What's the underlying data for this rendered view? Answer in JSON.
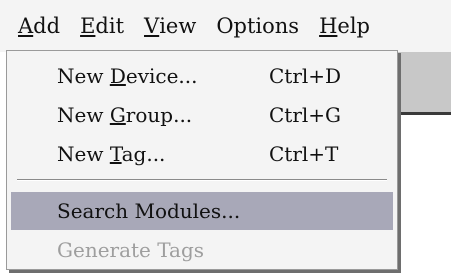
{
  "menubar": {
    "items": [
      {
        "label": "Add",
        "underline": "A",
        "rest": "dd"
      },
      {
        "label": "Edit",
        "underline": "E",
        "rest": "dit"
      },
      {
        "label": "View",
        "underline": "V",
        "rest": "iew"
      },
      {
        "label": "Options",
        "underline": "",
        "rest": "Options"
      },
      {
        "label": "Help",
        "underline": "H",
        "rest": "elp"
      }
    ]
  },
  "dropdown": {
    "items": [
      {
        "pre": "New ",
        "underline": "D",
        "post": "evice...",
        "shortcut": "Ctrl+D",
        "state": "normal"
      },
      {
        "pre": "New ",
        "underline": "G",
        "post": "roup...",
        "shortcut": "Ctrl+G",
        "state": "normal"
      },
      {
        "pre": "New ",
        "underline": "T",
        "post": "ag...",
        "shortcut": "Ctrl+T",
        "state": "normal"
      },
      {
        "pre": "Search Modules...",
        "underline": "",
        "post": "",
        "shortcut": "",
        "state": "highlighted"
      },
      {
        "pre": "Generate Tags",
        "underline": "",
        "post": "",
        "shortcut": "",
        "state": "disabled"
      }
    ]
  },
  "colors": {
    "menu_bg": "#f4f4f4",
    "highlight": "#a8a8b8",
    "disabled_text": "#9e9e9e"
  }
}
